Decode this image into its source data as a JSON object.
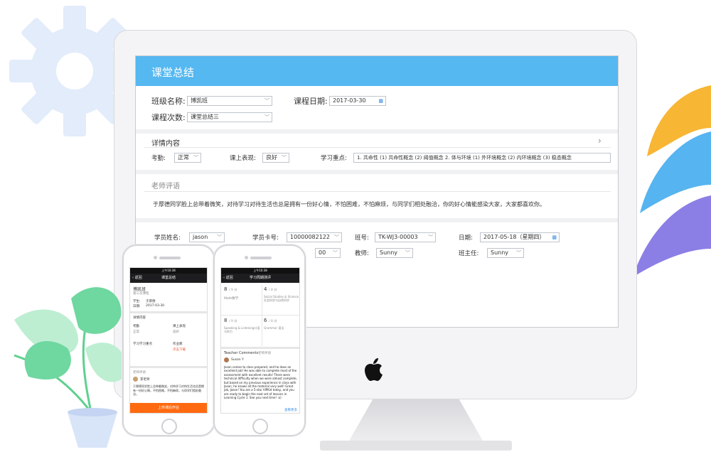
{
  "desktop": {
    "title": "课堂总结",
    "class_name_label": "班级名称:",
    "class_name_value": "博凯班",
    "course_date_label": "课程日期:",
    "course_date_value": "2017-03-30",
    "lesson_label": "课程次数:",
    "lesson_value": "课堂总结三",
    "details_title": "详情内容",
    "attendance_label": "考勤:",
    "attendance_value": "正常",
    "performance_label": "课上表现:",
    "performance_value": "良好",
    "focus_label": "学习重点:",
    "focus_value": "1. 共命性 (1) 共命性概念 (2) 阈值概念 2. 体与环境 (1) 外环境概念 (2) 内环境概念 (3) 稳态概念",
    "teacher_comment_title": "老师评语",
    "teacher_comment": "于厚德同学脸上总带着微笑，对待学习对待生活也总是拥有一份好心情，不怕困难，不怕麻烦，与同学们相处融洽，你的好心情能感染大家，大家都喜欢你。",
    "student_name_label": "学员姓名:",
    "student_name_value": "jason",
    "card_label": "学员卡号:",
    "card_value": "10000082122",
    "class_label": "班号:",
    "class_value": "TK-WJ3-00003",
    "date_label": "日期:",
    "date_value": "2017-05-18（星期四）",
    "partial_value": "00",
    "teacher_label": "教师:",
    "teacher_value": "Sunny",
    "head_teacher_label": "班主任:",
    "head_teacher_value": "Sunny"
  },
  "phone1": {
    "status": "上午10:38",
    "back": "返回",
    "title": "课堂总结",
    "class_name": "博凯班",
    "lesson": "第三次课程",
    "student_label": "学生:",
    "student_name": "于厚德",
    "date_label": "日期:",
    "date": "2017-03-30",
    "details": "详情内容",
    "attendance_label": "考勤",
    "attendance": "正常",
    "performance_label": "课上表现",
    "performance": "良好",
    "focus_label": "学习学习重点",
    "homework_label": "作业库",
    "homework_status": "点击下载",
    "comment_title": "老师评语",
    "teacher": "李老师",
    "comment": "于厚德同学脸上总带着微笑，对待学习对待生活也总是拥有一份好心情，不怕困难，不怕麻烦，与同学们相处融洽。",
    "button": "上传课后作业"
  },
  "phone2": {
    "status": "上午10:38",
    "back": "返回",
    "title": "学习周期测评",
    "scores": [
      {
        "score": "8",
        "max": "/ 9 分",
        "name": "Math数学"
      },
      {
        "score": "4",
        "max": "/ 8 分",
        "name": "Social Studies & Science社会科学与自然科学"
      },
      {
        "score": "8",
        "max": "/ 9 分",
        "name": "Speaking & Listening口语与听力"
      },
      {
        "score": "6",
        "max": "/ 8 分",
        "name": "Grammar 语法"
      }
    ],
    "comments_title": "Teacher Comments",
    "comments_title_cn": "老师评语",
    "teacher": "Susan Y",
    "comment": "Jason comes to class prepared, and he does an excellent job! He was able to complete most of the assessment with excellent results! There were technical difficulty when we were almost complete, but based on my previous experience in class with Jason, he knows all the material very well! Great job, Jason! You are a 5-star VIPKid today, and you are ready to begin the next set of lessons in Learning Cycle 1. See you next time! :o)",
    "more": "查看更多"
  }
}
